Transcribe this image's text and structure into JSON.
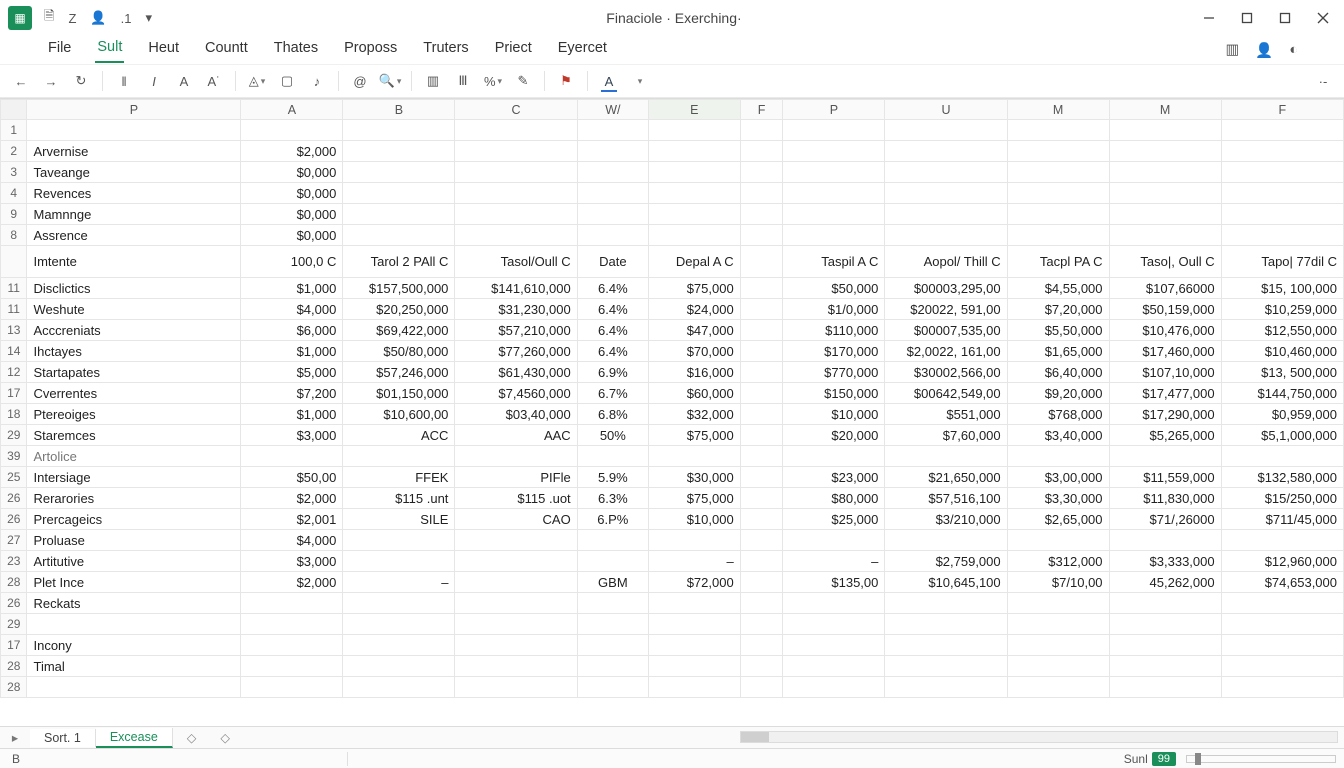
{
  "app": {
    "title": "Finaciole · Exerching·"
  },
  "qat": {
    "i1": "🗎",
    "i2": "Z",
    "i3": "👤",
    "i4": ".1",
    "i5": "▾"
  },
  "menu": {
    "items": [
      "File",
      "Sult",
      "Heut",
      "Countt",
      "Thates",
      "Proposs",
      "Truters",
      "Priect",
      "Eyercet"
    ],
    "activeIndex": 1
  },
  "cols": [
    "P",
    "A",
    "B",
    "C",
    "W/",
    "E",
    "F",
    "P",
    "U",
    "M",
    "M",
    "F"
  ],
  "selectedColIndex": 5,
  "rows": [
    {
      "n": "1",
      "label": "",
      "cells": [
        "",
        "",
        "",
        "",
        "",
        "",
        "",
        "",
        "",
        "",
        ""
      ]
    },
    {
      "n": "2",
      "label": "Arvernise",
      "cells": [
        "$2,000",
        "",
        "",
        "",
        "",
        "",
        "",
        "",
        "",
        "",
        ""
      ]
    },
    {
      "n": "3",
      "label": "Taveange",
      "cells": [
        "$0,000",
        "",
        "",
        "",
        "",
        "",
        "",
        "",
        "",
        "",
        ""
      ]
    },
    {
      "n": "4",
      "label": "Revences",
      "cells": [
        "$0,000",
        "",
        "",
        "",
        "",
        "",
        "",
        "",
        "",
        "",
        ""
      ]
    },
    {
      "n": "9",
      "label": "Mamnnge",
      "cells": [
        "$0,000",
        "",
        "",
        "",
        "",
        "",
        "",
        "",
        "",
        "",
        ""
      ]
    },
    {
      "n": "8",
      "label": "Assrence",
      "cells": [
        "$0,000",
        "",
        "",
        "",
        "",
        "",
        "",
        "",
        "",
        "",
        ""
      ]
    },
    {
      "n": "",
      "label": "Imtente",
      "header": true,
      "cells": [
        "100,0 C",
        "Tarol 2 PAll C",
        "Tasol/Oull C",
        "Date",
        "Depal A C",
        "",
        "Taspil A C",
        "Aopol/ Thill C",
        "Tacpl PA C",
        "Taso|, Oull C",
        "Tapo| 77dil C"
      ]
    },
    {
      "n": "11",
      "label": "Disclictics",
      "cells": [
        "$1,000",
        "$157,500,000",
        "$141,610,000",
        "6.4%",
        "$75,000",
        "",
        "$50,000",
        "$00003,295,00",
        "$4,55,000",
        "$107,66000",
        "$15, 100,000"
      ]
    },
    {
      "n": "11",
      "label": "Weshute",
      "cells": [
        "$4,000",
        "$20,250,000",
        "$31,230,000",
        "6.4%",
        "$24,000",
        "",
        "$1/0,000",
        "$20022, 591,00",
        "$7,20,000",
        "$50,159,000",
        "$10,259,000"
      ]
    },
    {
      "n": "13",
      "label": "Acccreniats",
      "cells": [
        "$6,000",
        "$69,422,000",
        "$57,210,000",
        "6.4%",
        "$47,000",
        "",
        "$110,000",
        "$00007,535,00",
        "$5,50,000",
        "$10,476,000",
        "$12,550,000"
      ]
    },
    {
      "n": "14",
      "label": "Ihctayes",
      "cells": [
        "$1,000",
        "$50/80,000",
        "$77,260,000",
        "6.4%",
        "$70,000",
        "",
        "$170,000",
        "$2,0022, 161,00",
        "$1,65,000",
        "$17,460,000",
        "$10,460,000"
      ]
    },
    {
      "n": "12",
      "label": "Startapates",
      "cells": [
        "$5,000",
        "$57,246,000",
        "$61,430,000",
        "6.9%",
        "$16,000",
        "",
        "$770,000",
        "$30002,566,00",
        "$6,40,000",
        "$107,10,000",
        "$13, 500,000"
      ]
    },
    {
      "n": "17",
      "label": "Cverrentes",
      "cells": [
        "$7,200",
        "$01,150,000",
        "$7,4560,000",
        "6.7%",
        "$60,000",
        "",
        "$150,000",
        "$00642,549,00",
        "$9,20,000",
        "$17,477,000",
        "$144,750,000"
      ]
    },
    {
      "n": "18",
      "label": "Ptereoiges",
      "cells": [
        "$1,000",
        "$10,600,00",
        "$03,40,000",
        "6.8%",
        "$32,000",
        "",
        "$10,000",
        "$551,000",
        "$768,000",
        "$17,290,000",
        "$0,959,000"
      ]
    },
    {
      "n": "29",
      "label": "Staremces",
      "cells": [
        "$3,000",
        "ACC",
        "AAC",
        "50%",
        "$75,000",
        "",
        "$20,000",
        "$7,60,000",
        "$3,40,000",
        "$5,265,000",
        "$5,1,000,000"
      ]
    },
    {
      "n": "39",
      "label": "Artolice",
      "section": true,
      "cells": [
        "",
        "",
        "",
        "",
        "",
        "",
        "",
        "",
        "",
        "",
        ""
      ]
    },
    {
      "n": "25",
      "label": "Intersiage",
      "cells": [
        "$50,00",
        "FFEK",
        "PIFle",
        "5.9%",
        "$30,000",
        "",
        "$23,000",
        "$21,650,000",
        "$3,00,000",
        "$11,559,000",
        "$132,580,000"
      ]
    },
    {
      "n": "26",
      "label": "Rerarories",
      "cells": [
        "$2,000",
        "$115 .unt",
        "$115 .uot",
        "6.3%",
        "$75,000",
        "",
        "$80,000",
        "$57,516,100",
        "$3,30,000",
        "$11,830,000",
        "$15/250,000"
      ]
    },
    {
      "n": "26",
      "label": "Prercageics",
      "cells": [
        "$2,001",
        "SILE",
        "CAO",
        "6.P%",
        "$10,000",
        "",
        "$25,000",
        "$3/210,000",
        "$2,65,000",
        "$71/,26000",
        "$711/45,000"
      ]
    },
    {
      "n": "27",
      "label": "Proluase",
      "cells": [
        "$4,000",
        "",
        "",
        "",
        "",
        "",
        "",
        "",
        "",
        "",
        ""
      ]
    },
    {
      "n": "23",
      "label": "Artitutive",
      "cells": [
        "$3,000",
        "",
        "",
        "",
        "–",
        "",
        "–",
        "$2,759,000",
        "$312,000",
        "$3,333,000",
        "$12,960,000"
      ]
    },
    {
      "n": "28",
      "label": "Plet Ince",
      "cells": [
        "$2,000",
        "–",
        "",
        "GBM",
        "$72,000",
        "",
        "$135,00",
        "$10,645,100",
        "$7/10,00",
        "45,262,000",
        "$74,653,000"
      ]
    },
    {
      "n": "26",
      "label": "Reckats",
      "cells": [
        "",
        "",
        "",
        "",
        "",
        "",
        "",
        "",
        "",
        "",
        ""
      ]
    },
    {
      "n": "29",
      "label": "",
      "cells": [
        "",
        "",
        "",
        "",
        "",
        "",
        "",
        "",
        "",
        "",
        ""
      ]
    },
    {
      "n": "17",
      "label": "Incony",
      "cells": [
        "",
        "",
        "",
        "",
        "",
        "",
        "",
        "",
        "",
        "",
        ""
      ]
    },
    {
      "n": "28",
      "label": "Timal",
      "cells": [
        "",
        "",
        "",
        "",
        "",
        "",
        "",
        "",
        "",
        "",
        ""
      ]
    },
    {
      "n": "28",
      "label": "",
      "cells": [
        "",
        "",
        "",
        "",
        "",
        "",
        "",
        "",
        "",
        "",
        ""
      ]
    }
  ],
  "tabs": {
    "items": [
      "Sort. 1",
      "Excease"
    ],
    "activeIndex": 1
  },
  "status": {
    "cell": "B",
    "label": "Sunl",
    "badge": "99"
  }
}
